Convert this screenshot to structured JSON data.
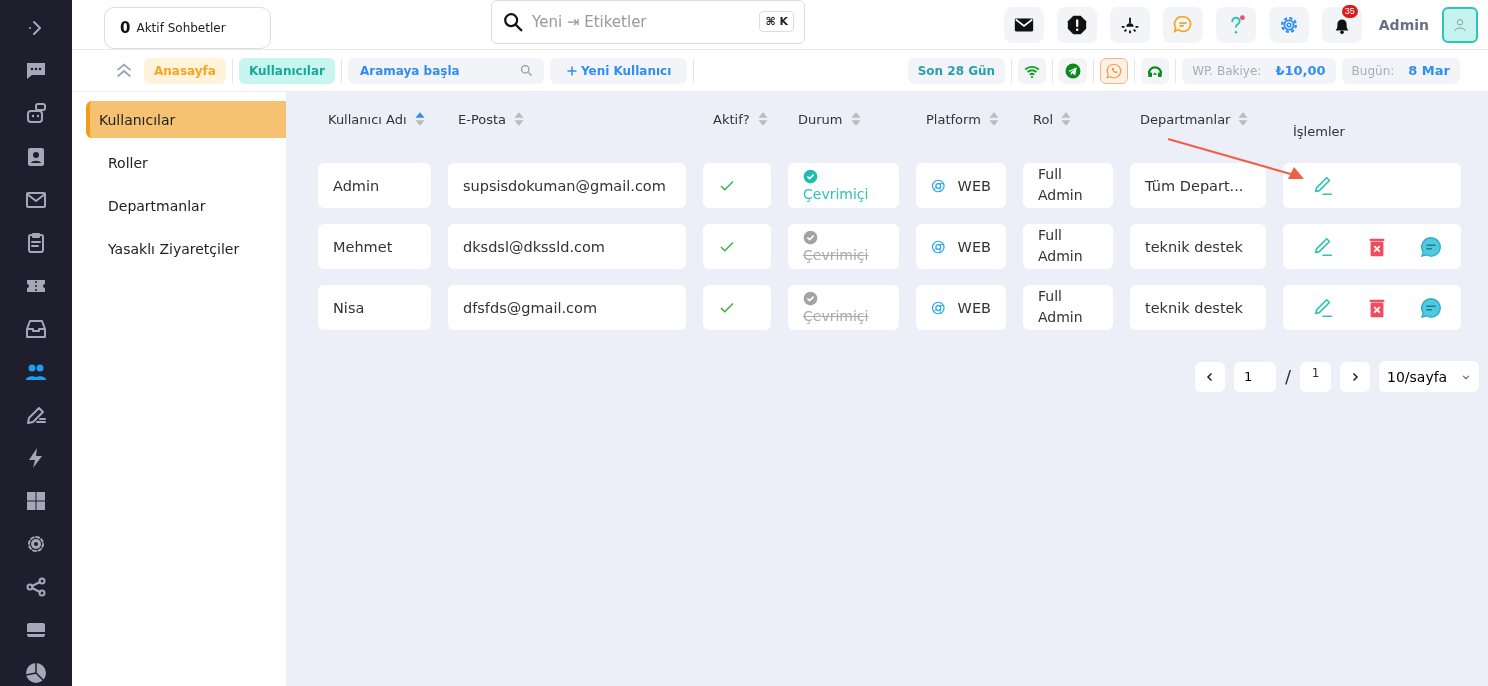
{
  "nav_rail": {
    "items": [
      {
        "selected": false
      },
      {
        "selected": false
      },
      {
        "selected": false
      },
      {
        "selected": false
      },
      {
        "selected": false
      },
      {
        "selected": false
      },
      {
        "selected": false
      },
      {
        "selected": false
      },
      {
        "selected": true
      },
      {
        "selected": false
      },
      {
        "selected": false
      },
      {
        "selected": false
      },
      {
        "selected": false
      },
      {
        "selected": false
      },
      {
        "selected": false
      },
      {
        "selected": false
      }
    ]
  },
  "header": {
    "active_chats": {
      "count": "0",
      "label": "Aktif Sohbetler"
    },
    "search": {
      "value": "Yeni ⇥ Etiketler",
      "shortcut": "⌘ K"
    },
    "notifications_badge": "35",
    "user_name": "Admin"
  },
  "toolbar": {
    "breadcrumbs": [
      {
        "label": "Anasayfa",
        "selected": false
      },
      {
        "label": "Kullanıcılar",
        "selected": true
      }
    ],
    "search": {
      "placeholder": "Aramaya başla"
    },
    "new_button": "Yeni Kullanıcı",
    "period": "Son 28 Gün",
    "channels": [
      {
        "selected": false
      },
      {
        "selected": false
      },
      {
        "selected": true
      },
      {
        "selected": false
      }
    ],
    "balance": {
      "label": "WP. Bakiye:",
      "value": "₺10,00"
    },
    "today": {
      "label": "Bugün:",
      "value": "8 Mar"
    }
  },
  "sidebar": {
    "items": [
      {
        "label": "Kullanıcılar",
        "selected": true
      },
      {
        "label": "Roller",
        "selected": false
      },
      {
        "label": "Departmanlar",
        "selected": false
      },
      {
        "label": "Yasaklı Ziyaretçiler",
        "selected": false
      }
    ]
  },
  "table": {
    "columns": [
      {
        "label": "Kullanıcı Adı",
        "sorted": true
      },
      {
        "label": "E-Posta",
        "sorted": false
      },
      {
        "label": "Aktif?",
        "sorted": false
      },
      {
        "label": "Durum",
        "sorted": false
      },
      {
        "label": "Platform",
        "sorted": false
      },
      {
        "label": "Rol",
        "sorted": false
      },
      {
        "label": "Departmanlar",
        "sorted": false
      },
      {
        "label": "İşlemler"
      }
    ],
    "rows": [
      {
        "username": "Admin",
        "email": "supsisdokuman@gmail.com",
        "active": true,
        "status": {
          "label": "Çevrimiçi",
          "online": true
        },
        "platform": "WEB",
        "role": "Full Admin",
        "department": "Tüm Depart...",
        "actions": [
          {
            "kind": "edit"
          }
        ]
      },
      {
        "username": "Mehmet",
        "email": "dksdsl@dkssld.com",
        "active": true,
        "status": {
          "label": "Çevrimiçi",
          "online": false
        },
        "platform": "WEB",
        "role": "Full Admin",
        "department": "teknik destek",
        "actions": [
          {
            "kind": "edit"
          },
          {
            "kind": "delete"
          },
          {
            "kind": "chat"
          }
        ]
      },
      {
        "username": "Nisa",
        "email": "dfsfds@gmail.com",
        "active": true,
        "status": {
          "label": "Çevrimiçi",
          "online": false
        },
        "platform": "WEB",
        "role": "Full Admin",
        "department": "teknik destek",
        "actions": [
          {
            "kind": "edit"
          },
          {
            "kind": "delete"
          },
          {
            "kind": "chat"
          }
        ]
      }
    ]
  },
  "pagination": {
    "page": "1",
    "separator": "/",
    "total": "1",
    "per_page": "10/sayfa"
  }
}
